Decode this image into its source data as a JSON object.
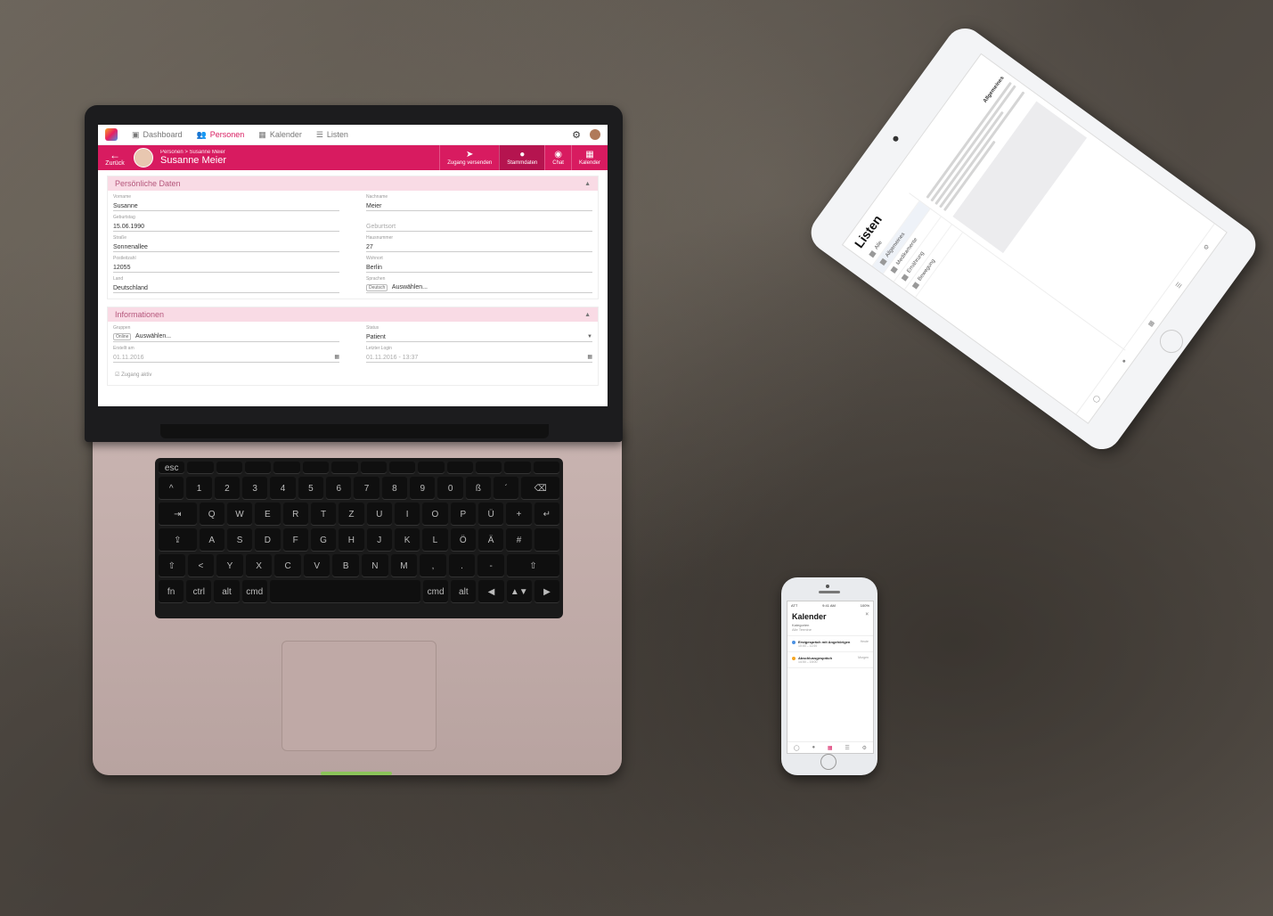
{
  "laptop": {
    "nav": {
      "dashboard": "Dashboard",
      "personen": "Personen",
      "kalender": "Kalender",
      "listen": "Listen"
    },
    "header": {
      "back": "Zurück",
      "breadcrumb": "Personen > Susanne Meier",
      "name": "Susanne Meier",
      "actions": [
        {
          "label": "Zugang versenden",
          "icon": "paper-plane-icon"
        },
        {
          "label": "Stammdaten",
          "icon": "person-icon"
        },
        {
          "label": "Chat",
          "icon": "chat-icon"
        },
        {
          "label": "Kalender",
          "icon": "calendar-icon"
        }
      ]
    },
    "sections": {
      "personal_title": "Persönliche Daten",
      "info_title": "Informationen"
    },
    "fields": {
      "vorname_label": "Vorname",
      "vorname": "Susanne",
      "nachname_label": "Nachname",
      "nachname": "Meier",
      "geburtstag_label": "Geburtstag",
      "geburtstag": "15.06.1990",
      "geburtsort_placeholder": "Geburtsort",
      "strasse_label": "Straße",
      "strasse": "Sonnenallee",
      "hausnummer_label": "Hausnummer",
      "hausnummer": "27",
      "plz_label": "Postleitzahl",
      "plz": "12055",
      "ort_label": "Wohnort",
      "ort": "Berlin",
      "land_label": "Land",
      "land": "Deutschland",
      "sprachen_label": "Sprachen",
      "sprachen_chip": "Deutsch",
      "sprachen_select": "Auswählen...",
      "gruppen_label": "Gruppen",
      "gruppen_chip": "Online",
      "gruppen_select": "Auswählen...",
      "status_label": "Status",
      "status": "Patient",
      "erstellt_label": "Erstellt am",
      "erstellt": "01.11.2016",
      "letzter_label": "Letzter Login",
      "letzter": "01.11.2016 - 13:37",
      "zugang": "Zugang aktiv"
    }
  },
  "tablet": {
    "title": "Listen",
    "items": [
      "Alle",
      "Allgemeines",
      "Medikamente",
      "Ernährung",
      "Bewegung"
    ],
    "detail_title": "Allgemeines"
  },
  "phone": {
    "status_left": "ATT",
    "status_center": "9:41 AM",
    "status_right": "100%",
    "title": "Kalender",
    "close": "×",
    "subtitle": "Kategorien",
    "subtitle2": "Alle Termine",
    "events": [
      {
        "title": "Erstgespräch mit Angehörigen",
        "sub": "10:00 – 11:00",
        "time": "Heute",
        "color": "#4a90e2"
      },
      {
        "title": "Abschlussgespräch",
        "sub": "14:00 – 15:00",
        "time": "Morgen",
        "color": "#f5a623"
      }
    ]
  }
}
